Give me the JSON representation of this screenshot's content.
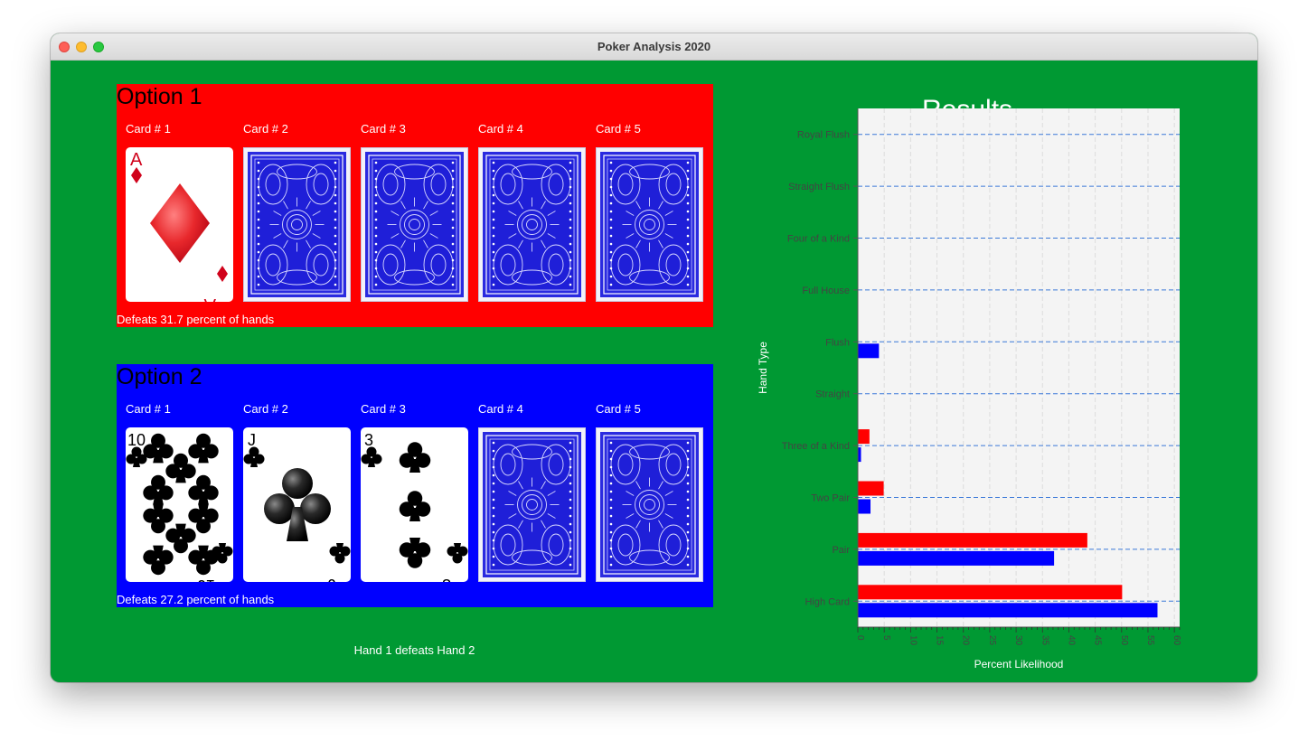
{
  "window": {
    "title": "Poker Analysis 2020"
  },
  "option1": {
    "title": "Option 1",
    "color": "#ff0000",
    "card_labels": [
      "Card # 1",
      "Card # 2",
      "Card # 3",
      "Card # 4",
      "Card # 5"
    ],
    "cards": [
      {
        "rank": "A",
        "suit": "diamonds",
        "face_up": true
      },
      {
        "face_up": false
      },
      {
        "face_up": false
      },
      {
        "face_up": false
      },
      {
        "face_up": false
      }
    ],
    "footer": "Defeats 31.7 percent of hands"
  },
  "option2": {
    "title": "Option 2",
    "color": "#0000ff",
    "card_labels": [
      "Card # 1",
      "Card # 2",
      "Card # 3",
      "Card # 4",
      "Card # 5"
    ],
    "cards": [
      {
        "rank": "10",
        "suit": "clubs",
        "face_up": true
      },
      {
        "rank": "J",
        "suit": "clubs",
        "face_up": true
      },
      {
        "rank": "3",
        "suit": "clubs",
        "face_up": true
      },
      {
        "face_up": false
      },
      {
        "face_up": false
      }
    ],
    "footer": "Defeats 27.2 percent of hands"
  },
  "verdict": "Hand 1 defeats Hand 2",
  "results": {
    "title": "Results"
  },
  "chart_data": {
    "type": "bar",
    "orientation": "horizontal",
    "xlabel": "Percent Likelihood",
    "ylabel": "Hand Type",
    "categories": [
      "Royal Flush",
      "Straight Flush",
      "Four of a Kind",
      "Full House",
      "Flush",
      "Straight",
      "Three of a Kind",
      "Two Pair",
      "Pair",
      "High Card"
    ],
    "series": [
      {
        "color": "#ff0000",
        "values": [
          0,
          0,
          0,
          0,
          0,
          0,
          2.2,
          4.9,
          43.5,
          50.1
        ]
      },
      {
        "color": "#0000ff",
        "values": [
          0,
          0,
          0,
          0,
          4.0,
          0,
          0.6,
          2.4,
          37.2,
          56.8
        ]
      }
    ],
    "xlim": [
      0,
      61
    ],
    "xticks": [
      0,
      5,
      10,
      15,
      20,
      25,
      30,
      35,
      40,
      45,
      50,
      55,
      60
    ],
    "grid": true
  }
}
